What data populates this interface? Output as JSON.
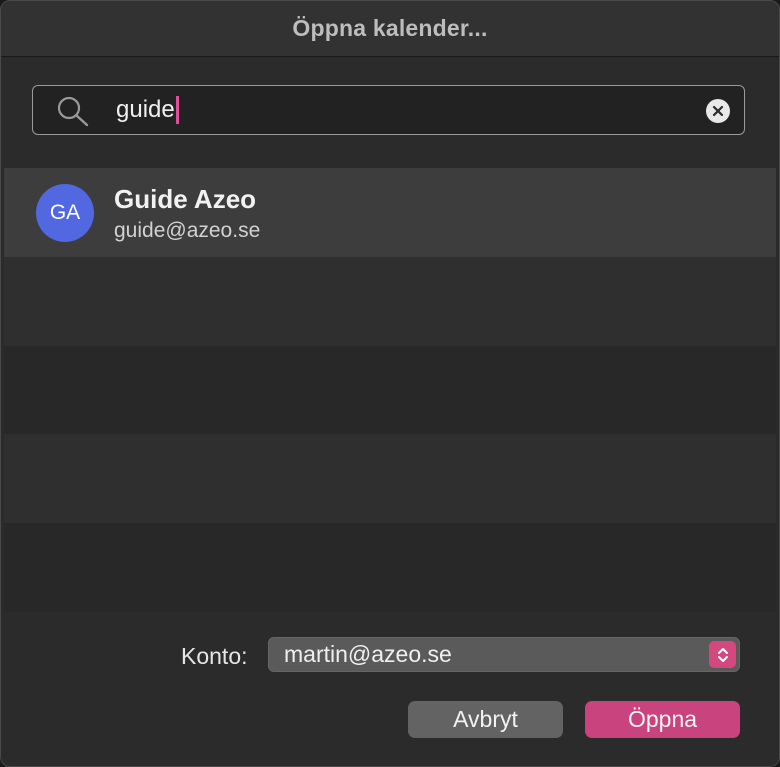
{
  "window": {
    "title": "Öppna kalender..."
  },
  "search": {
    "value": "guide"
  },
  "results": [
    {
      "initials": "GA",
      "name": "Guide Azeo",
      "email": "guide@azeo.se",
      "avatar_color": "#5268e0"
    }
  ],
  "footer": {
    "account_label": "Konto:",
    "account_value": "martin@azeo.se",
    "cancel_label": "Avbryt",
    "open_label": "Öppna"
  },
  "colors": {
    "accent": "#c9437f",
    "caret": "#e0509a"
  },
  "icons": {
    "search": "search-icon",
    "clear": "clear-icon",
    "stepper": "chevron-up-down-icon"
  }
}
